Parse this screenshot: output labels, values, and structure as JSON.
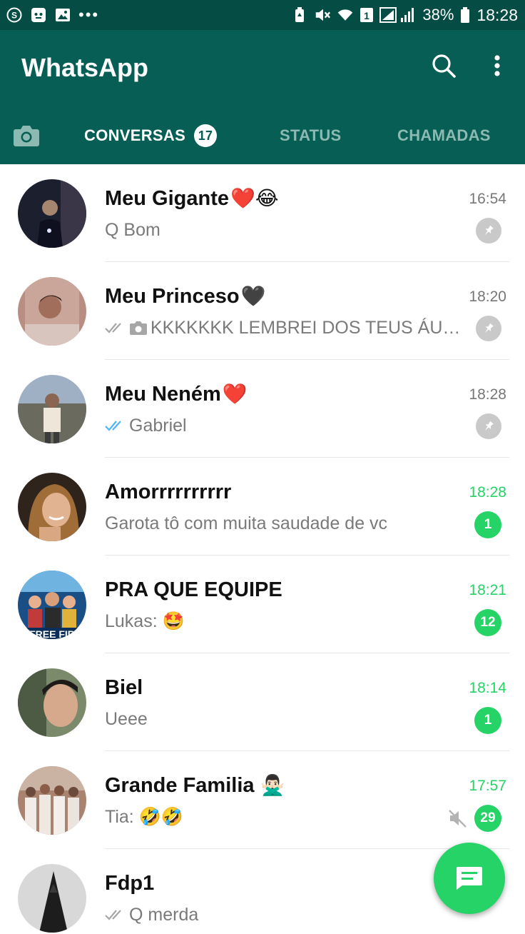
{
  "status_bar": {
    "left_icons": [
      "s-icon",
      "bear-app-icon",
      "gallery-icon"
    ],
    "more_dots": "•••",
    "battery_percent": "38%",
    "time": "18:28",
    "sim_slot": "1"
  },
  "app_bar": {
    "title": "WhatsApp",
    "colors": {
      "primary": "#075e54",
      "status_bar": "#054d44",
      "accent": "#25d366"
    }
  },
  "tabs": {
    "conversas": {
      "label": "CONVERSAS",
      "badge": "17"
    },
    "status": {
      "label": "STATUS"
    },
    "chamadas": {
      "label": "CHAMADAS"
    }
  },
  "chats": [
    {
      "name": "Meu Gigante",
      "emoji": "❤️😂",
      "time": "16:54",
      "preview": "Q Bom",
      "pinned": true,
      "unread": "",
      "ticks": "none",
      "media": false
    },
    {
      "name": "Meu Princeso",
      "emoji": "🖤",
      "time": "18:20",
      "preview": "KKKKKKK LEMBREI DOS TEUS ÁUDIOS",
      "pinned": true,
      "unread": "",
      "ticks": "grey",
      "media": true
    },
    {
      "name": "Meu Neném",
      "emoji": "❤️",
      "time": "18:28",
      "preview": "Gabriel",
      "pinned": true,
      "unread": "",
      "ticks": "blue",
      "media": false
    },
    {
      "name": "Amorrrrrrrrrr",
      "emoji": "",
      "time": "18:28",
      "preview": "Garota tô com muita saudade de vc",
      "pinned": false,
      "unread": "1",
      "ticks": "none",
      "media": false
    },
    {
      "name": "PRA QUE EQUIPE",
      "emoji": "",
      "time": "18:21",
      "preview": "Lukas: 🤩",
      "pinned": false,
      "unread": "12",
      "ticks": "none",
      "media": false
    },
    {
      "name": "Biel",
      "emoji": "",
      "time": "18:14",
      "preview": "Ueee",
      "pinned": false,
      "unread": "1",
      "ticks": "none",
      "media": false
    },
    {
      "name": "Grande Familia",
      "emoji": "🙅🏻‍♂️",
      "time": "17:57",
      "preview": "Tia: 🤣🤣",
      "pinned": false,
      "unread": "29",
      "muted": true,
      "ticks": "none",
      "media": false
    },
    {
      "name": "Fdp1",
      "emoji": "",
      "time": "",
      "preview": "Q merda",
      "pinned": false,
      "unread": "",
      "ticks": "grey",
      "media": false
    }
  ],
  "fab": {
    "icon": "new-chat-icon"
  }
}
